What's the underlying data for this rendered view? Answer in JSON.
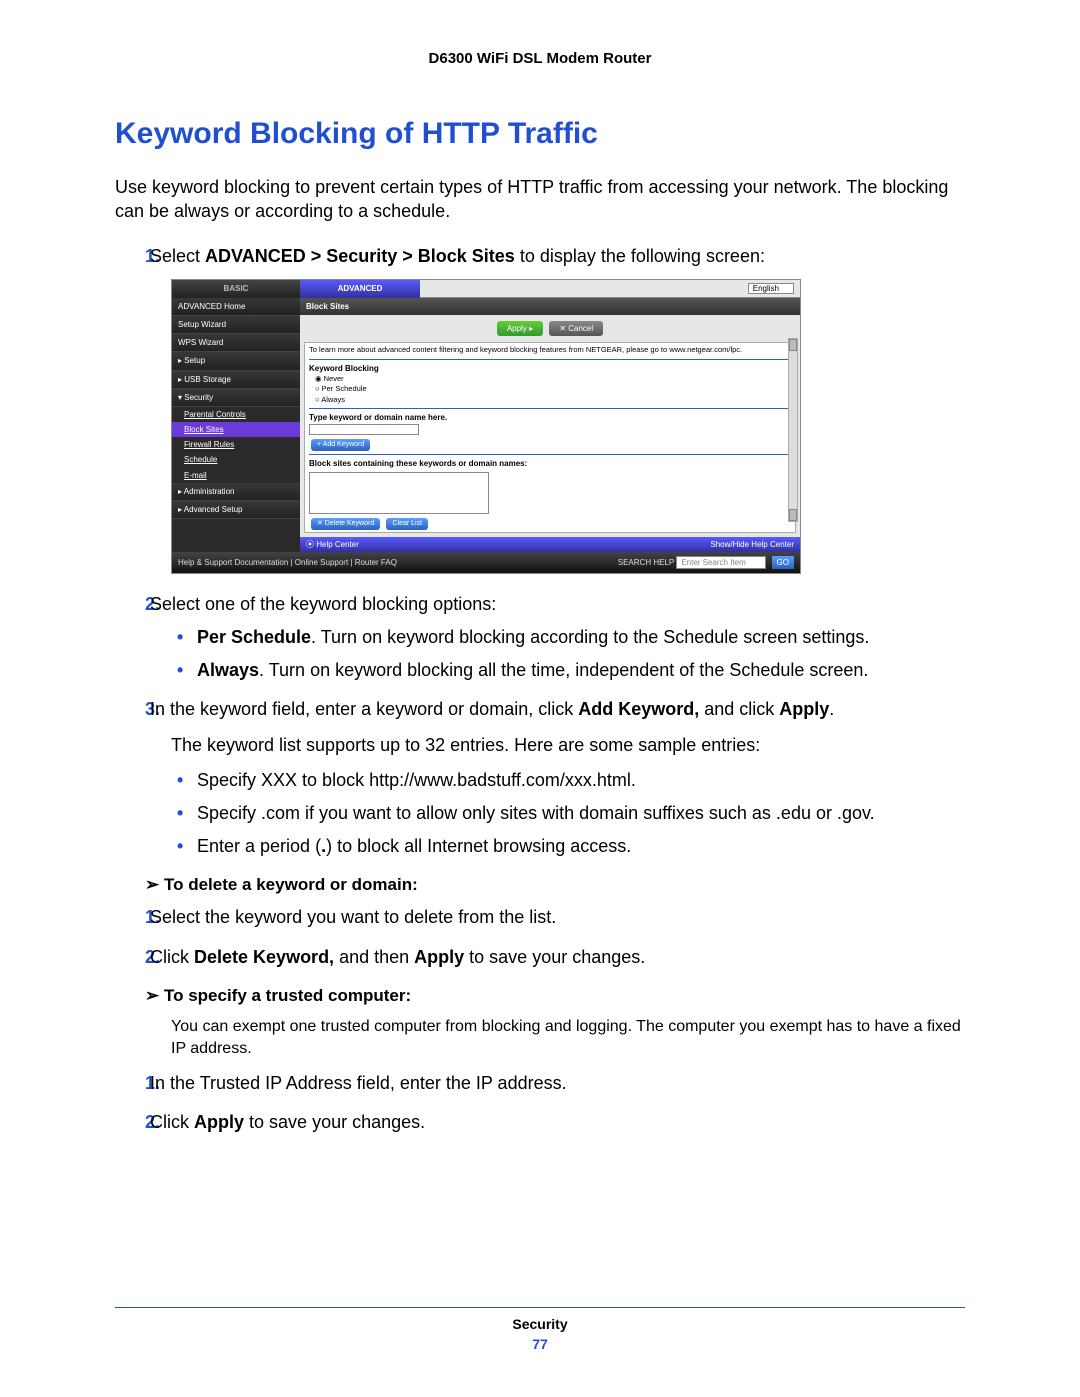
{
  "header": {
    "product": "D6300 WiFi DSL Modem Router"
  },
  "section": {
    "title": "Keyword Blocking of HTTP Traffic",
    "intro": "Use keyword blocking to prevent certain types of HTTP traffic from accessing your network. The blocking can be always or according to a schedule."
  },
  "steps": {
    "s1_pre": "Select ",
    "s1_bold": "ADVANCED > Security > Block Sites",
    "s1_post": " to display the following screen:",
    "s2": "Select one of the keyword blocking options:",
    "s2_b1_bold": "Per Schedule",
    "s2_b1_rest": ". Turn on keyword blocking according to the Schedule screen settings.",
    "s2_b2_bold": "Always",
    "s2_b2_rest": ". Turn on keyword blocking all the time, independent of the Schedule screen.",
    "s3_a": "In the keyword field, enter a keyword or domain, click ",
    "s3_b": "Add Keyword,",
    "s3_c": " and click ",
    "s3_d": "Apply",
    "s3_e": ".",
    "s3_sub": "The keyword list supports up to 32 entries. Here are some sample entries:",
    "s3_bul1": "Specify XXX to block http://www.badstuff.com/xxx.html.",
    "s3_bul2": "Specify .com if you want to allow only sites with domain suffixes such as .edu or .gov.",
    "s3_bul3_a": "Enter a period (",
    "s3_bul3_b": ".",
    "s3_bul3_c": ") to block all Internet browsing access."
  },
  "proc_delete": {
    "title": "To delete a keyword or domain:",
    "s1": "Select the keyword you want to delete from the list.",
    "s2_a": "Click ",
    "s2_b": "Delete Keyword,",
    "s2_c": " and then ",
    "s2_d": "Apply",
    "s2_e": " to save your changes."
  },
  "proc_trusted": {
    "title": "To specify a trusted computer:",
    "intro": "You can exempt one trusted computer from blocking and logging. The computer you exempt has to have a fixed IP address.",
    "s1": "In the Trusted IP Address field, enter the IP address.",
    "s2_a": "Click ",
    "s2_b": "Apply",
    "s2_c": " to save your changes."
  },
  "footer": {
    "chapter": "Security",
    "page": "77"
  },
  "router": {
    "tabs": {
      "basic": "BASIC",
      "advanced": "ADVANCED",
      "language": "English"
    },
    "sidebar": {
      "items": [
        "ADVANCED Home",
        "Setup Wizard",
        "WPS Wizard",
        "▸ Setup",
        "▸ USB Storage",
        "▾ Security"
      ],
      "sub": [
        "Parental Controls",
        "Block Sites",
        "Firewall Rules",
        "Schedule",
        "E-mail"
      ],
      "items2": [
        "▸ Administration",
        "▸ Advanced Setup"
      ]
    },
    "main": {
      "title": "Block Sites",
      "apply": "Apply ▸",
      "cancel": "✕ Cancel",
      "note": "To learn more about advanced content filtering and keyword blocking features from NETGEAR, please go to www.netgear.com/lpc.",
      "kb_label": "Keyword Blocking",
      "opt_never": "Never",
      "opt_sched": "Per Schedule",
      "opt_always": "Always",
      "type_label": "Type keyword or domain name here.",
      "add_kw": "+ Add Keyword",
      "block_label": "Block sites containing these keywords or domain names:",
      "del_kw": "✕ Delete Keyword",
      "clear": "Clear List",
      "help_center": "⦿ Help Center",
      "show_hide": "Show/Hide Help Center"
    },
    "footer": {
      "left": "Help & Support  Documentation | Online Support | Router FAQ",
      "search_label": "SEARCH HELP",
      "search_ph": "Enter Search Item",
      "go": "GO"
    }
  }
}
